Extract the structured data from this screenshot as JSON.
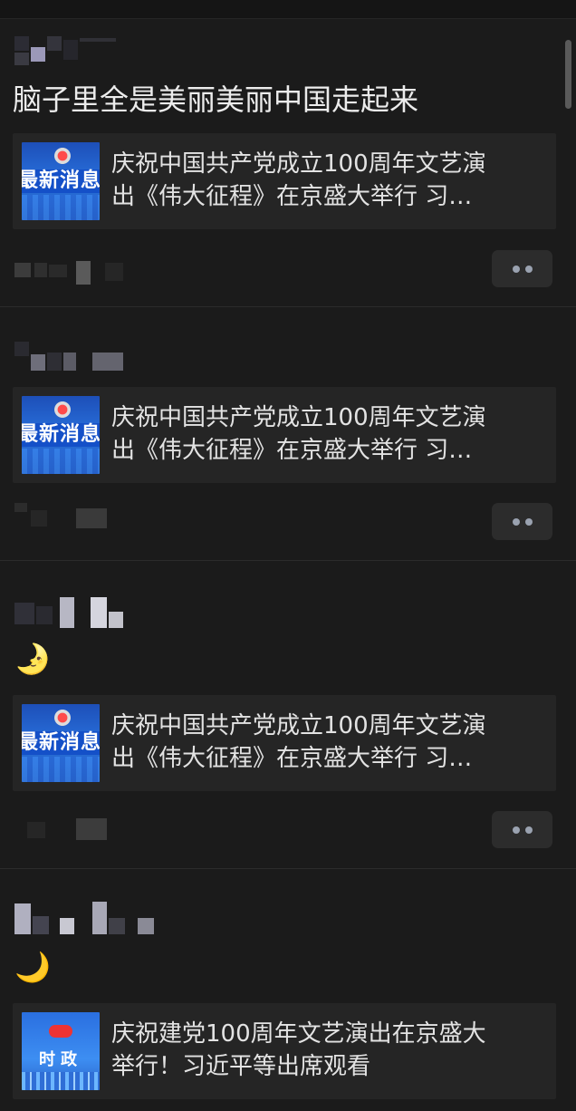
{
  "posts": [
    {
      "text": "脑子里全是美丽美丽中国走起来",
      "card": {
        "line1": "庆祝中国共产党成立100周年文艺演",
        "line2": "出《伟大征程》在京盛大举行  习…",
        "thumb_text": "最新消息"
      }
    },
    {
      "text": "",
      "card": {
        "line1": "庆祝中国共产党成立100周年文艺演",
        "line2": "出《伟大征程》在京盛大举行  习…",
        "thumb_text": "最新消息"
      }
    },
    {
      "emoji": "🌛",
      "card": {
        "line1": "庆祝中国共产党成立100周年文艺演",
        "line2": "出《伟大征程》在京盛大举行  习…",
        "thumb_text": "最新消息"
      }
    },
    {
      "emoji": "🌙",
      "card": {
        "line1": "庆祝建党100周年文艺演出在京盛大",
        "line2": "举行！习近平等出席观看",
        "thumb_text": "时政"
      }
    }
  ],
  "colors": {
    "background": "#1b1b1b",
    "card": "#252525",
    "divider": "#2c2c2c",
    "more_dots": "#9aa2b0"
  },
  "icons": {
    "more_button": "more-dots-icon"
  }
}
